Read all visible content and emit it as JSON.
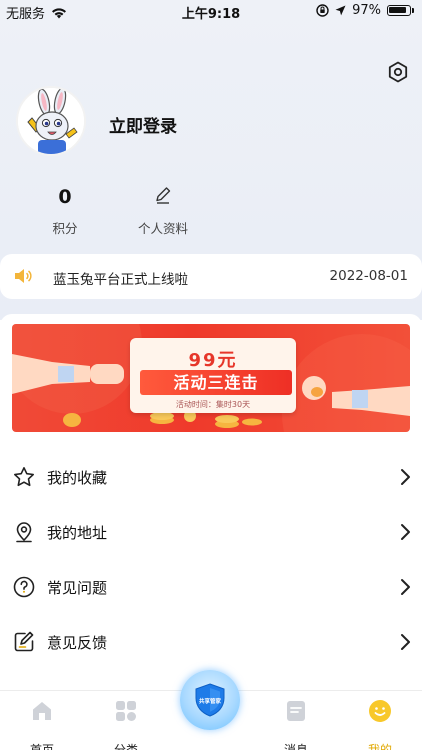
{
  "status_bar": {
    "carrier": "无服务",
    "time": "上午9:18",
    "battery": "97%"
  },
  "profile": {
    "login_text": "立即登录"
  },
  "stats": {
    "points_value": "0",
    "points_label": "积分",
    "profile_label": "个人资料"
  },
  "notice": {
    "text": "蓝玉兔平台正式上线啦",
    "date": "2022-08-01"
  },
  "banner": {
    "title": "99元",
    "ribbon": "活动三连击",
    "subtitle": "活动时间：集时30天"
  },
  "menu": [
    {
      "label": "我的收藏",
      "icon": "star-icon"
    },
    {
      "label": "我的地址",
      "icon": "location-pin-icon"
    },
    {
      "label": "常见问题",
      "icon": "question-icon"
    },
    {
      "label": "意见反馈",
      "icon": "feedback-edit-icon"
    }
  ],
  "tabs": [
    {
      "label": "首页",
      "icon": "home-icon"
    },
    {
      "label": "分类",
      "icon": "category-grid-icon"
    },
    {
      "label": "共享管家",
      "icon": "shield-icon"
    },
    {
      "label": "消息",
      "icon": "message-icon"
    },
    {
      "label": "我的",
      "icon": "smile-face-icon"
    }
  ],
  "colors": {
    "accent": "#e1a800",
    "banner_red": "#ef3a2b",
    "header_bg": "#eef1f7"
  }
}
